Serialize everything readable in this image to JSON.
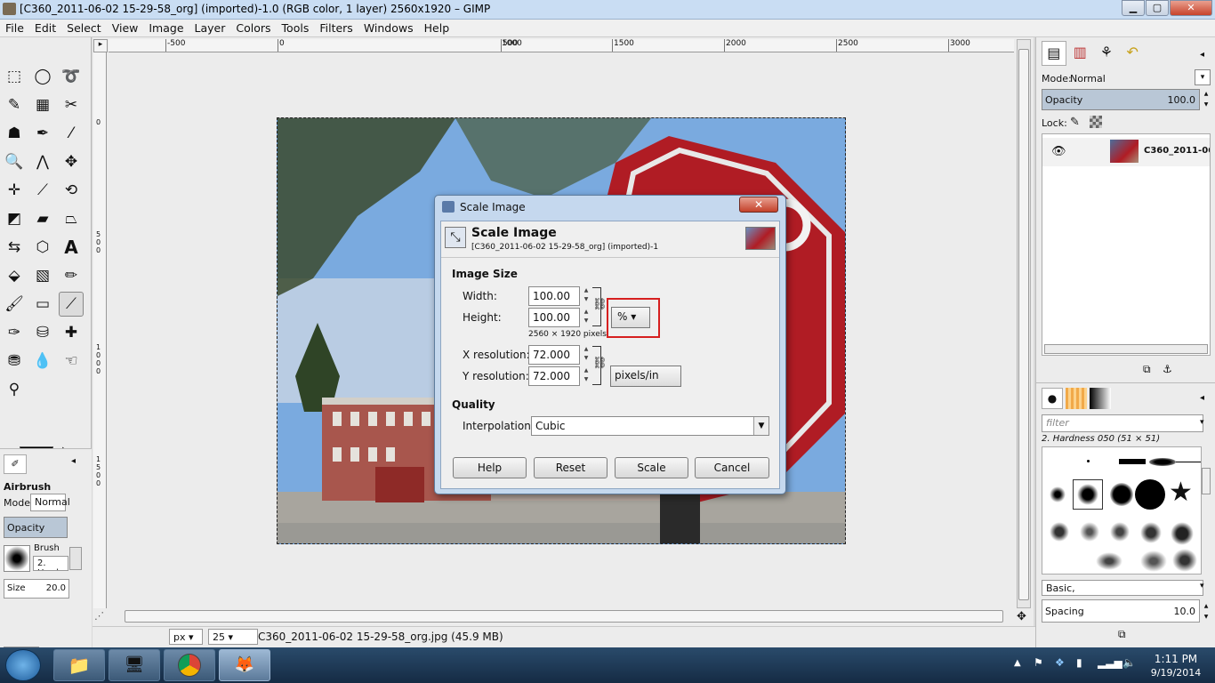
{
  "window": {
    "title": "[C360_2011-06-02 15-29-58_org] (imported)-1.0 (RGB color, 1 layer) 2560x1920 – GIMP",
    "minimize": "▁",
    "maximize": "▢",
    "close": "✕"
  },
  "menu": [
    "File",
    "Edit",
    "Select",
    "View",
    "Image",
    "Layer",
    "Colors",
    "Tools",
    "Filters",
    "Windows",
    "Help"
  ],
  "ruler": {
    "h_labels": [
      "-500",
      "0",
      "500",
      "1000",
      "1500",
      "2000",
      "2500",
      "3000"
    ],
    "v_labels": [
      "0",
      "5",
      "0",
      "0",
      "1",
      "0",
      "0",
      "0",
      "1",
      "5",
      "0",
      "0"
    ]
  },
  "tool_options": {
    "title": "Airbrush",
    "mode_label": "Mode:",
    "mode_value": "Normal",
    "opacity_label": "Opacity",
    "brush_label": "Brush",
    "brush_value": "2. Hardn",
    "size_label": "Size",
    "size_value": "20.0"
  },
  "status": {
    "unit": "px",
    "zoom": "25",
    "filename": "C360_2011-06-02 15-29-58_org.jpg (45.9 MB)"
  },
  "layers": {
    "mode_label": "Mode:",
    "mode_value": "Normal",
    "opacity_label": "Opacity",
    "opacity_value": "100.0",
    "lock_label": "Lock:",
    "layer_name": "C360_2011-06-0"
  },
  "brushes": {
    "filter_placeholder": "filter",
    "selected": "2. Hardness 050 (51 × 51)",
    "preset": "Basic,",
    "spacing_label": "Spacing",
    "spacing_value": "10.0"
  },
  "dialog": {
    "title": "Scale Image",
    "header": "Scale Image",
    "subheader": "[C360_2011-06-02 15-29-58_org] (imported)-1",
    "image_size_label": "Image Size",
    "width_label": "Width:",
    "width_value": "100.00",
    "height_label": "Height:",
    "height_value": "100.00",
    "pixel_info": "2560 × 1920 pixels",
    "unit_value": "%",
    "xres_label": "X resolution:",
    "xres_value": "72.000",
    "yres_label": "Y resolution:",
    "yres_value": "72.000",
    "res_unit": "pixels/in",
    "quality_label": "Quality",
    "interp_label": "Interpolation:",
    "interp_value": "Cubic",
    "buttons": {
      "help": "Help",
      "reset": "Reset",
      "scale": "Scale",
      "cancel": "Cancel"
    },
    "highlight_color": "#d61f1f"
  },
  "taskbar": {
    "time": "1:11 PM",
    "date": "9/19/2014"
  },
  "colors": {
    "title_bg": "#c9ddf3",
    "stop_red": "#b01c24"
  }
}
